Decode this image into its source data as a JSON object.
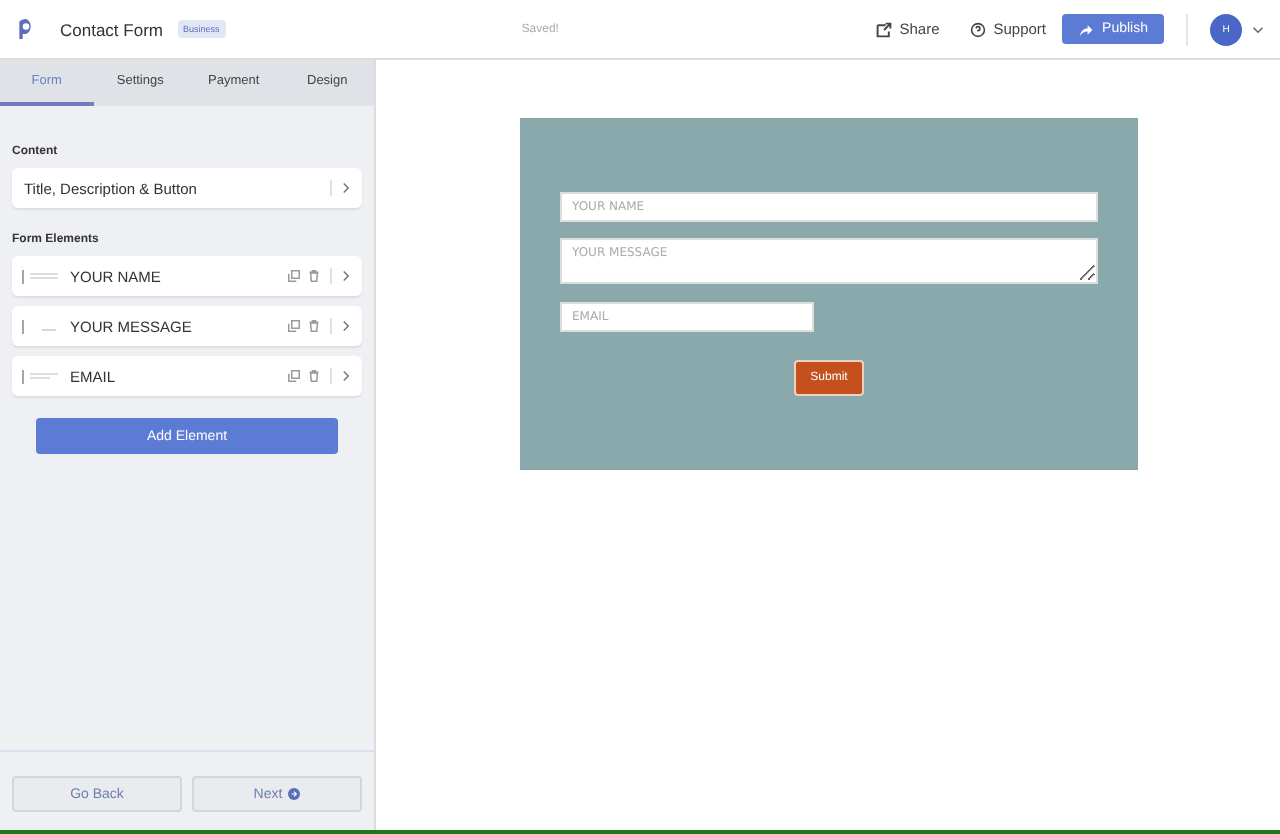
{
  "header": {
    "title": "Contact Form",
    "badge": "Business",
    "status": "Saved!",
    "share": "Share",
    "support": "Support",
    "publish": "Publish",
    "avatar": "H"
  },
  "tabs": [
    {
      "label": "Form",
      "selected": true
    },
    {
      "label": "Settings",
      "selected": false
    },
    {
      "label": "Payment",
      "selected": false
    },
    {
      "label": "Design",
      "selected": false
    }
  ],
  "content": {
    "heading": "Content",
    "item": "Title, Description & Button"
  },
  "form_elements": {
    "heading": "Form Elements",
    "items": [
      {
        "label": "YOUR NAME",
        "kind": "text"
      },
      {
        "label": "YOUR MESSAGE",
        "kind": "textarea"
      },
      {
        "label": "EMAIL",
        "kind": "email"
      }
    ],
    "add_button": "Add Element"
  },
  "footer": {
    "back": "Go Back",
    "next": "Next"
  },
  "preview": {
    "fields": [
      {
        "placeholder": "YOUR NAME",
        "kind": "text"
      },
      {
        "placeholder": "YOUR MESSAGE",
        "kind": "textarea"
      },
      {
        "placeholder": "EMAIL",
        "kind": "email"
      }
    ],
    "submit": "Submit"
  }
}
